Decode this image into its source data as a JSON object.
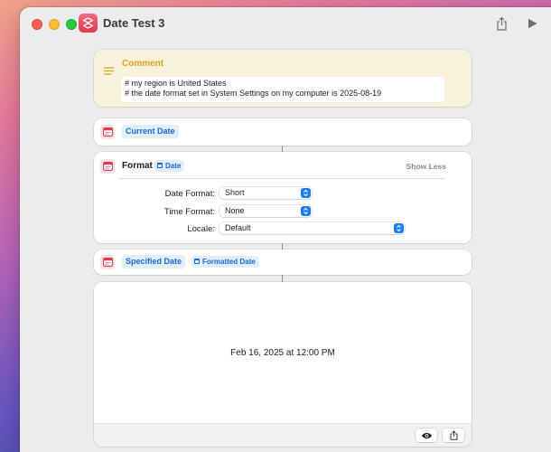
{
  "window": {
    "title": "Date Test 3"
  },
  "comment": {
    "title": "Comment",
    "lines": [
      "# my region is United States",
      "# the date format set in System Settings on my computer is 2025-08-19"
    ]
  },
  "current_date": {
    "label": "Current Date"
  },
  "format": {
    "title": "Format",
    "input_label": "Date",
    "toggle_label": "Show Less",
    "date_format": {
      "label": "Date Format:",
      "value": "Short"
    },
    "time_format": {
      "label": "Time Format:",
      "value": "None"
    },
    "locale": {
      "label": "Locale:",
      "value": "Default"
    }
  },
  "specified_date": {
    "label": "Specified Date",
    "input_label": "Formatted Date"
  },
  "output": {
    "text": "Feb 16, 2025 at 12:00 PM"
  },
  "icons": {
    "app": "shortcuts-icon",
    "share": "share-icon",
    "run": "play-icon",
    "comment": "comment-lines-icon",
    "action": "calendar-icon",
    "preview": "eye-icon",
    "output_share": "share-icon"
  },
  "colors": {
    "accent": "#1a7ef2",
    "comment_title": "#d7a51c",
    "action_icon": "#e0384f"
  }
}
